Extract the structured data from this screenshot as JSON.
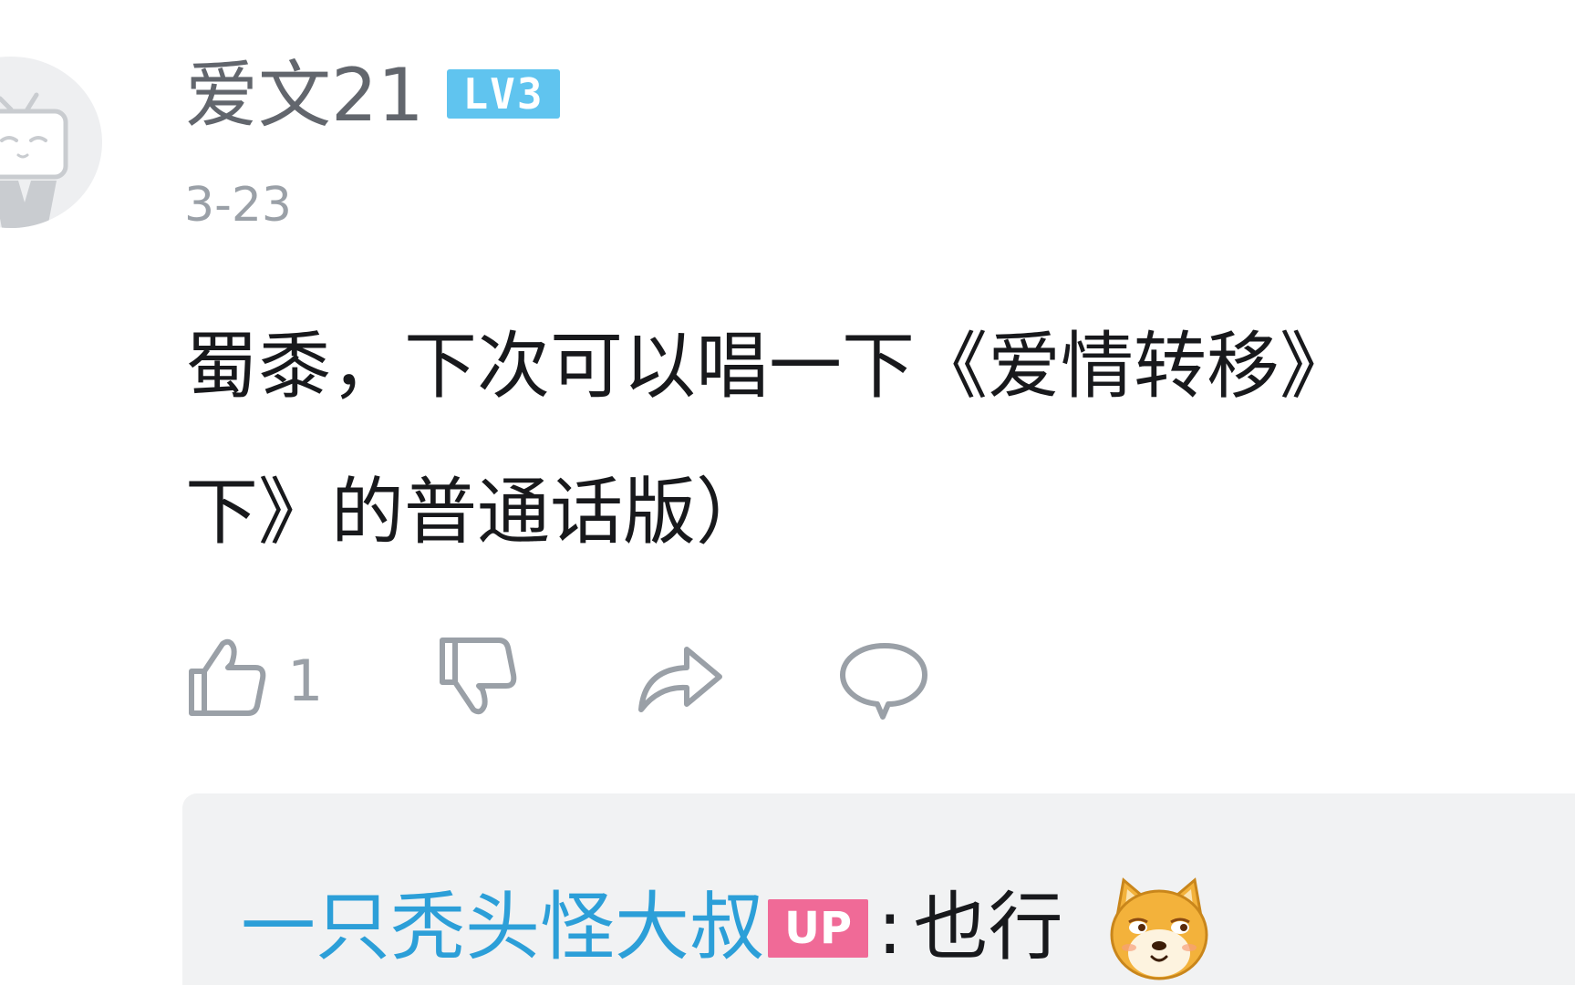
{
  "comment": {
    "username": "爱文21",
    "level_badge": "LV3",
    "date": "3-23",
    "text_lines": [
      "蜀黍，下次可以唱一下《爱情转移》",
      "下》的普通话版）"
    ],
    "like_count": "1"
  },
  "actions": {
    "like_icon": "thumbs-up-icon",
    "dislike_icon": "thumbs-down-icon",
    "share_icon": "share-arrow-icon",
    "reply_icon": "comment-bubble-icon"
  },
  "reply": {
    "author": "一只秃头怪大叔",
    "badge": "UP",
    "separator": ":",
    "text": "也行",
    "emoji": "doge-icon"
  },
  "colors": {
    "username": "#62666d",
    "level_badge": "#60c4ef",
    "reply_author": "#2c9fd8",
    "up_badge": "#f06a97",
    "icon_gray": "#9aa0a7",
    "reply_bg": "#f1f2f3"
  }
}
